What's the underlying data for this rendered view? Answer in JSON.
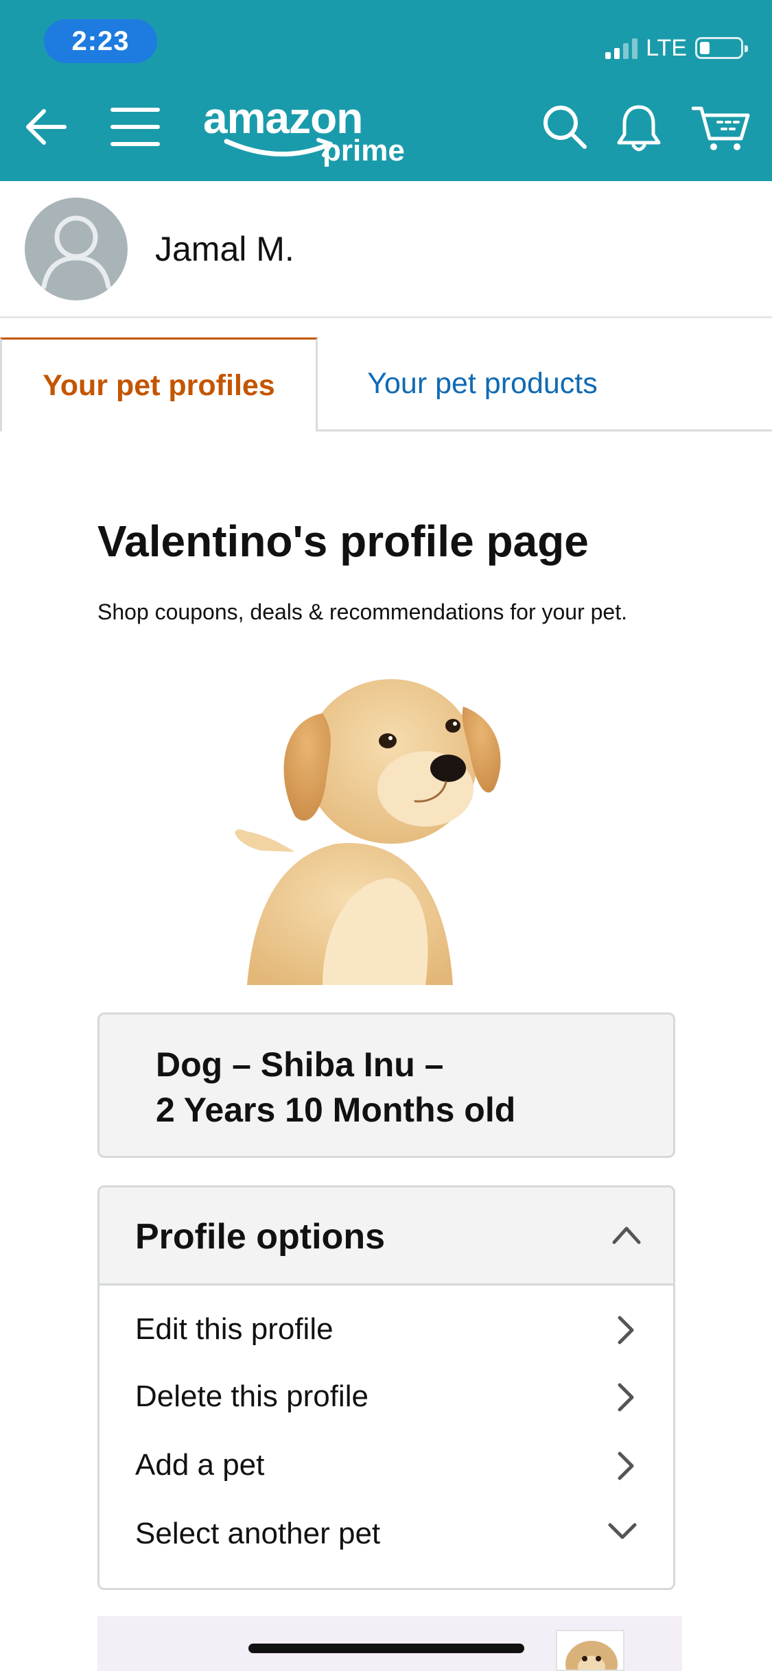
{
  "status_bar": {
    "time": "2:23",
    "network": "LTE"
  },
  "nav": {
    "brand_word": "amazon",
    "brand_sub": "prime",
    "icons": [
      "back-arrow-icon",
      "menu-icon",
      "search-icon",
      "bell-icon",
      "cart-icon"
    ]
  },
  "user": {
    "name": "Jamal M."
  },
  "tabs": {
    "active": "Your pet profiles",
    "inactive": "Your pet products"
  },
  "profile": {
    "title": "Valentino's profile page",
    "subtitle": "Shop coupons, deals & recommendations for your pet.",
    "info_line1": "Dog – Shiba Inu –",
    "info_line2": "2 Years 10 Months old"
  },
  "options": {
    "title": "Profile options",
    "items": [
      {
        "label": "Edit this profile"
      },
      {
        "label": "Delete this profile"
      },
      {
        "label": "Add a pet"
      },
      {
        "label": "Select another pet"
      }
    ]
  },
  "colors": {
    "header": "#1a9bab",
    "time_pill": "#1e7be0",
    "tab_active": "#c45500",
    "link": "#0f6ab4"
  }
}
